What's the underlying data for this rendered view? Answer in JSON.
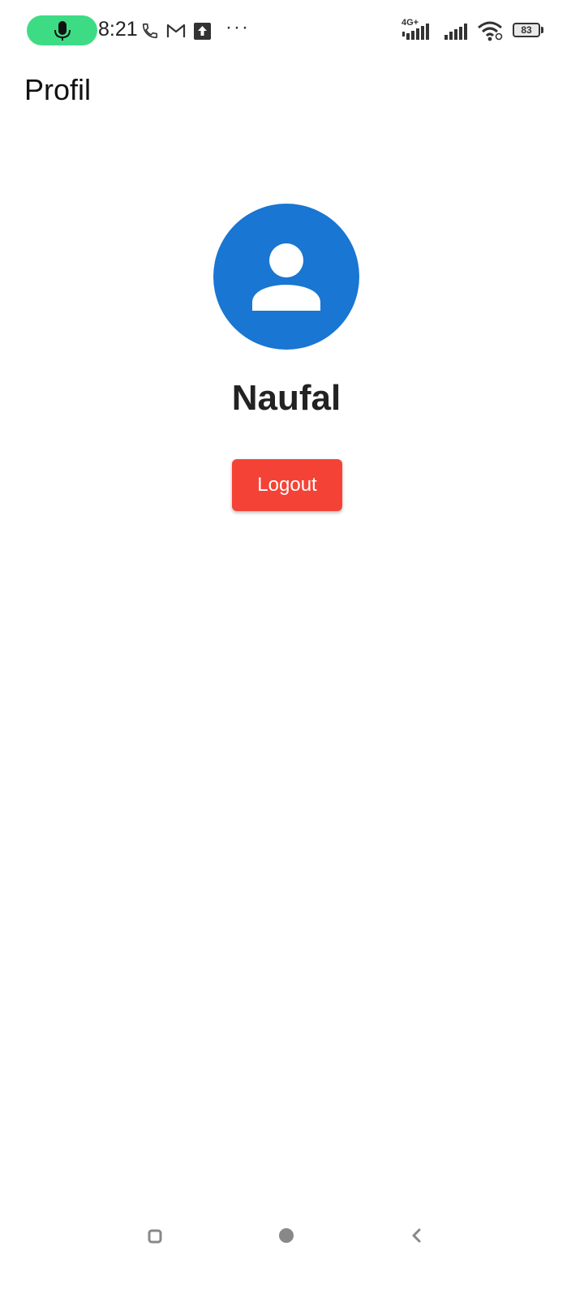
{
  "status_bar": {
    "time": "8:21",
    "network_type": "4G+",
    "battery_level": "83",
    "more_indicator": "···",
    "icons": [
      "microphone-icon",
      "phone-icon",
      "gmail-icon",
      "upload-icon",
      "signal-icon",
      "wifi-icon",
      "battery-icon"
    ],
    "accent_color": "#3ddc84"
  },
  "app_bar": {
    "title": "Profil"
  },
  "profile": {
    "name": "Naufal",
    "avatar_icon": "person-icon",
    "avatar_color": "#1976d2"
  },
  "actions": {
    "logout_label": "Logout",
    "logout_color": "#f44336"
  },
  "nav_bar": {
    "icons": [
      "recent-apps-icon",
      "home-icon",
      "back-icon"
    ]
  }
}
